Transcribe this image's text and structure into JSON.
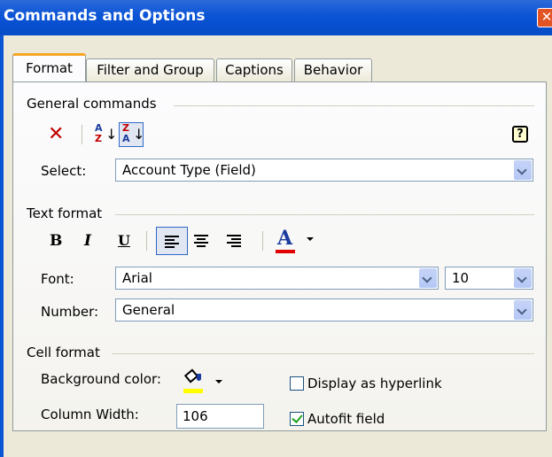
{
  "window": {
    "title": "Commands and Options",
    "close_glyph": "✕"
  },
  "tabs": [
    {
      "label": "Format",
      "active": true
    },
    {
      "label": "Filter and Group",
      "active": false
    },
    {
      "label": "Captions",
      "active": false
    },
    {
      "label": "Behavior",
      "active": false
    }
  ],
  "general_commands": {
    "heading": "General commands",
    "delete_glyph": "✕",
    "sort_asc": {
      "top": "A",
      "bottom": "Z"
    },
    "sort_desc": {
      "top": "Z",
      "bottom": "A"
    },
    "help_glyph": "?",
    "select_label": "Select:",
    "select_value": "Account Type (Field)"
  },
  "text_format": {
    "heading": "Text format",
    "bold_glyph": "B",
    "italic_glyph": "I",
    "underline_glyph": "U",
    "font_color_glyph": "A",
    "font_color": "#e00000",
    "font_label": "Font:",
    "font_value": "Arial",
    "size_value": "10",
    "number_label": "Number:",
    "number_value": "General"
  },
  "cell_format": {
    "heading": "Cell format",
    "background_label": "Background color:",
    "background_color": "#ffff00",
    "column_width_label": "Column Width:",
    "column_width_value": "106",
    "hyperlink_label": "Display as hyperlink",
    "hyperlink_checked": false,
    "autofit_label": "Autofit field",
    "autofit_checked": true
  }
}
